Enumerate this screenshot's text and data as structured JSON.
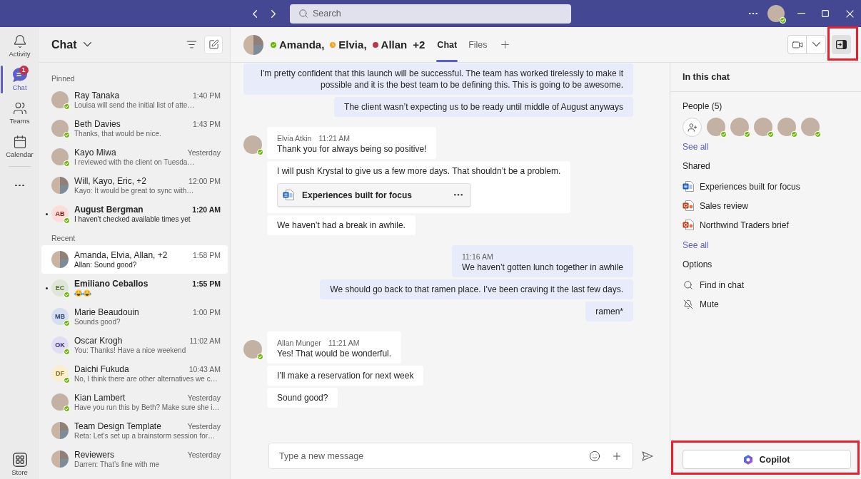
{
  "title_bar": {
    "search": {
      "placeholder": "Search"
    },
    "user": {
      "available": true
    }
  },
  "rail": {
    "items": [
      {
        "kind": "activity",
        "label": "Activity",
        "selected": false
      },
      {
        "kind": "chat",
        "label": "Chat",
        "selected": true,
        "badge": "1"
      },
      {
        "kind": "teams",
        "label": "Teams",
        "selected": false
      },
      {
        "kind": "calendar",
        "label": "Calendar",
        "selected": false
      }
    ],
    "bottom_items": [
      {
        "kind": "store",
        "label": "Store",
        "selected": false
      }
    ]
  },
  "chat_list": {
    "title": "Chat",
    "sections": [
      {
        "label": "Pinned",
        "chats": [
          {
            "name": "Ray Tanaka",
            "time": "1:40 PM",
            "preview": "Louisa will send the initial list of atte…",
            "avatar": {
              "kind": "photo"
            },
            "available": true,
            "unread": false,
            "selected": false
          },
          {
            "name": "Beth Davies",
            "time": "1:43 PM",
            "preview": "Thanks, that would be nice.",
            "avatar": {
              "kind": "photo"
            },
            "available": true,
            "unread": false,
            "selected": false
          },
          {
            "name": "Kayo Miwa",
            "time": "Yesterday",
            "preview": "I reviewed with the client on Tuesda…",
            "avatar": {
              "kind": "photo"
            },
            "available": true,
            "unread": false,
            "selected": false
          },
          {
            "name": "Will, Kayo, Eric, +2",
            "time": "12:00 PM",
            "preview": "Kayo: It would be great to sync with…",
            "avatar": {
              "kind": "group"
            },
            "available": false,
            "unread": false,
            "selected": false
          },
          {
            "name": "August Bergman",
            "time": "1:20 AM",
            "preview": "I haven't checked available times yet",
            "avatar": {
              "kind": "initials",
              "initials": "AB",
              "color": "#fbdedb"
            },
            "available": true,
            "unread": true,
            "selected": false
          }
        ]
      },
      {
        "label": "Recent",
        "chats": [
          {
            "name": "Amanda, Elvia, Allan, +2",
            "time": "1:58 PM",
            "preview": "Allan: Sound good?",
            "avatar": {
              "kind": "group"
            },
            "available": false,
            "unread": false,
            "selected": true
          },
          {
            "name": "Emiliano Ceballos",
            "time": "1:55 PM",
            "preview_emojis": [
              {
                "kind": "tears-of-joy"
              },
              {
                "kind": "tears-of-joy"
              }
            ],
            "avatar": {
              "kind": "initials",
              "initials": "EC",
              "color": "#dfe5d8"
            },
            "available": true,
            "unread": true,
            "selected": false
          },
          {
            "name": "Marie Beaudouin",
            "time": "1:00 PM",
            "preview": "Sounds good?",
            "avatar": {
              "kind": "initials",
              "initials": "MB",
              "color": "#d5dff0"
            },
            "available": true,
            "unread": false,
            "selected": false
          },
          {
            "name": "Oscar Krogh",
            "time": "11:02 AM",
            "preview": "You: Thanks! Have a nice weekend",
            "avatar": {
              "kind": "initials",
              "initials": "OK",
              "color": "#e1def2"
            },
            "available": true,
            "unread": false,
            "selected": false
          },
          {
            "name": "Daichi Fukuda",
            "time": "10:43 AM",
            "preview": "No, I think there are other alternatives we c…",
            "avatar": {
              "kind": "initials",
              "initials": "DF",
              "color": "#f9eecf"
            },
            "available": true,
            "unread": false,
            "selected": false
          },
          {
            "name": "Kian Lambert",
            "time": "Yesterday",
            "preview": "Have you run this by Beth? Make sure she i…",
            "avatar": {
              "kind": "photo"
            },
            "available": true,
            "unread": false,
            "selected": false
          },
          {
            "name": "Team Design Template",
            "time": "Yesterday",
            "preview": "Reta: Let’s set up a brainstorm session for…",
            "avatar": {
              "kind": "group"
            },
            "available": false,
            "unread": false,
            "selected": false
          },
          {
            "name": "Reviewers",
            "time": "Yesterday",
            "preview": "Darren: That’s fine with me",
            "avatar": {
              "kind": "group"
            },
            "available": false,
            "unread": false,
            "selected": false
          }
        ]
      }
    ]
  },
  "conversation": {
    "header": {
      "participants": [
        {
          "name": "Amanda,",
          "kind": "available"
        },
        {
          "name": "Elvia,",
          "kind": "away"
        },
        {
          "name": "Allan",
          "kind": "busy"
        }
      ],
      "more": "+2",
      "tabs": [
        {
          "label": "Chat",
          "selected": true
        },
        {
          "label": "Files",
          "selected": false
        }
      ],
      "panel_toggle": {
        "selected": true,
        "highlighted": true
      }
    },
    "messages": [
      {
        "kind": "outgoing",
        "messages": [
          {
            "text": "I'm pretty confident that this launch will be successful. The team has worked tirelessly to make it possible and it is the best team to be defining this. This is going to be awesome."
          },
          {
            "text": "The client wasn’t expecting us to be ready until middle of August anyways"
          }
        ]
      },
      {
        "kind": "incoming",
        "sender": "Elvia Atkin",
        "time": "11:21 AM",
        "available": true,
        "messages": [
          {
            "text": "Thank you for always being so positive!"
          },
          {
            "text": "I will push Krystal to give us a few more days. That shouldn’t be a problem.",
            "attachment": {
              "kind": "word",
              "name": "Experiences built for focus"
            }
          },
          {
            "text": "We haven’t had a break in awhile."
          }
        ]
      },
      {
        "kind": "outgoing",
        "time": "11:16 AM",
        "messages": [
          {
            "text": "We haven’t gotten lunch together in awhile"
          },
          {
            "text": "We should go back to that ramen place. I’ve been craving it the last few days."
          },
          {
            "text": "ramen*"
          }
        ]
      },
      {
        "kind": "incoming",
        "sender": "Allan Munger",
        "time": "11:21 AM",
        "available": true,
        "messages": [
          {
            "text": "Yes! That would be wonderful."
          },
          {
            "text": "I’ll make a reservation for next week"
          },
          {
            "text": "Sound good?"
          }
        ]
      }
    ],
    "composer": {
      "placeholder": "Type a new message"
    }
  },
  "right_panel": {
    "title": "In this chat",
    "people": {
      "label": "People (5)",
      "members": [
        {
          "available": true
        },
        {
          "available": true
        },
        {
          "available": true
        },
        {
          "available": true
        },
        {
          "available": true
        }
      ],
      "see_all": "See all"
    },
    "shared": {
      "label": "Shared",
      "files": [
        {
          "kind": "word",
          "name": "Experiences built for focus"
        },
        {
          "kind": "powerpoint",
          "name": "Sales review"
        },
        {
          "kind": "powerpoint",
          "name": "Northwind Traders brief"
        }
      ],
      "see_all": "See all"
    },
    "options": {
      "label": "Options",
      "items": [
        {
          "kind": "search",
          "label": "Find in chat"
        },
        {
          "kind": "mute",
          "label": "Mute"
        }
      ]
    },
    "copilot": {
      "label": "Copilot",
      "highlighted": true
    }
  }
}
